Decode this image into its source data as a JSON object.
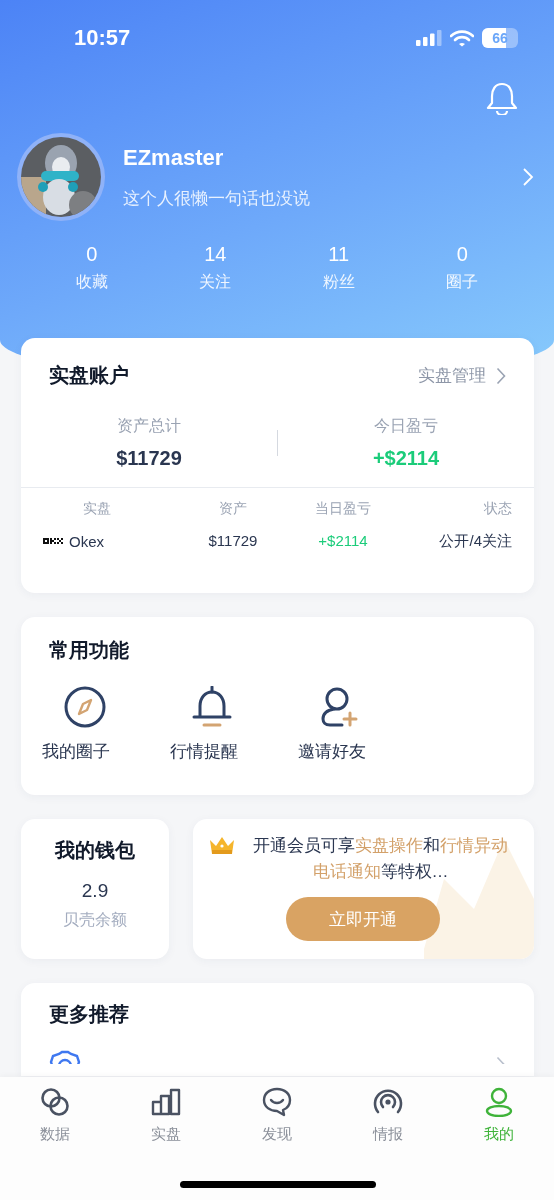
{
  "status_bar": {
    "time": "10:57",
    "battery": {
      "text": "66",
      "level": 0.66
    }
  },
  "profile": {
    "name": "EZmaster",
    "bio": "这个人很懒一句话也没说"
  },
  "stats": [
    {
      "value": "0",
      "label": "收藏"
    },
    {
      "value": "14",
      "label": "关注"
    },
    {
      "value": "11",
      "label": "粉丝"
    },
    {
      "value": "0",
      "label": "圈子"
    }
  ],
  "account": {
    "title": "实盘账户",
    "manage_link": "实盘管理",
    "summary": [
      {
        "label": "资产总计",
        "value": "$11729",
        "kind": "neutral"
      },
      {
        "label": "今日盈亏",
        "value": "+$2114",
        "kind": "positive"
      }
    ],
    "columns": [
      "实盘",
      "资产",
      "当日盈亏",
      "状态"
    ],
    "rows": [
      {
        "exchange": "Okex",
        "assets": "$11729",
        "pnl": "+$2114",
        "pnl_positive": true,
        "status": "公开/4关注"
      }
    ]
  },
  "functions": {
    "title": "常用功能",
    "items": [
      {
        "label": "我的圈子",
        "kind": "compass"
      },
      {
        "label": "行情提醒",
        "kind": "bell"
      },
      {
        "label": "邀请好友",
        "kind": "invite"
      }
    ]
  },
  "wallet": {
    "title": "我的钱包",
    "balance": "2.9",
    "label": "贝壳余额"
  },
  "vip": {
    "segments": [
      {
        "text": "开通会员可享",
        "highlight": false
      },
      {
        "text": "实盘操作",
        "highlight": true
      },
      {
        "text": "和",
        "highlight": false
      },
      {
        "text": "行情异动电话通知",
        "highlight": true
      },
      {
        "text": "等特权…",
        "highlight": false
      }
    ],
    "button": "立即开通"
  },
  "more": {
    "title": "更多推荐"
  },
  "tabs": [
    {
      "label": "数据",
      "kind": "data",
      "selected": false
    },
    {
      "label": "实盘",
      "kind": "bars",
      "selected": false
    },
    {
      "label": "发现",
      "kind": "chat",
      "selected": false
    },
    {
      "label": "情报",
      "kind": "signal",
      "selected": false
    },
    {
      "label": "我的",
      "kind": "person",
      "selected": true
    }
  ]
}
